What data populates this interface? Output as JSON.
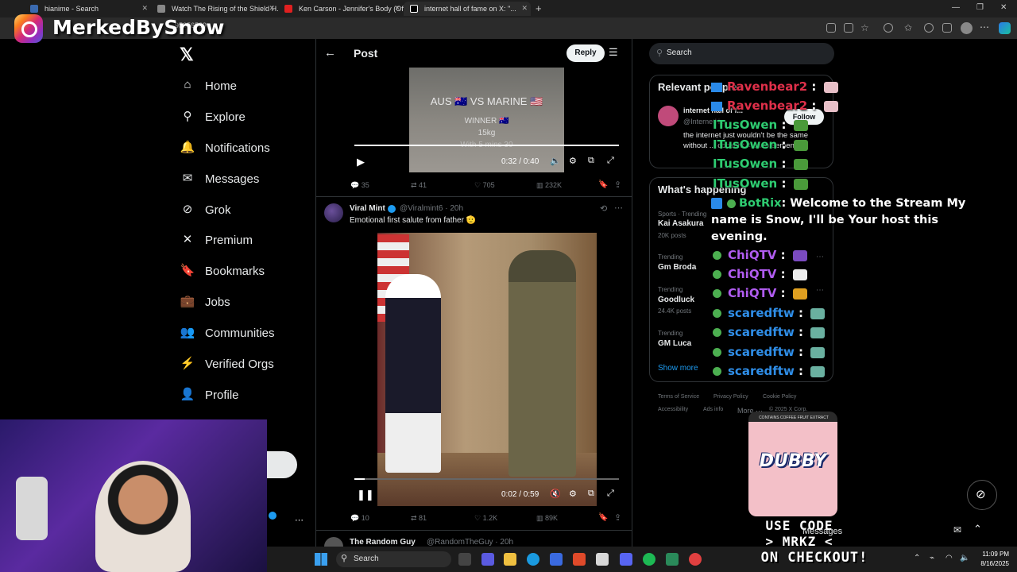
{
  "browser": {
    "tabs": [
      {
        "title": "hianime - Search",
        "active": false
      },
      {
        "title": "Watch The Rising of the Shield H...",
        "active": false
      },
      {
        "title": "Ken Carson - Jennifer's Body (Off...",
        "active": false
      },
      {
        "title": "internet hall of fame on X: \"...",
        "active": true
      }
    ],
    "url_fragment": "95656589"
  },
  "overlay": {
    "channel_name": "MerkedBySnow",
    "promo_line1": "USE CODE",
    "promo_line2": "> MRKZ <",
    "promo_line3": "ON CHECKOUT!"
  },
  "sidebar": {
    "items": [
      {
        "label": "Home",
        "icon": "home-icon"
      },
      {
        "label": "Explore",
        "icon": "search-icon"
      },
      {
        "label": "Notifications",
        "icon": "bell-icon"
      },
      {
        "label": "Messages",
        "icon": "mail-icon"
      },
      {
        "label": "Grok",
        "icon": "grok-icon"
      },
      {
        "label": "Premium",
        "icon": "x-icon"
      },
      {
        "label": "Bookmarks",
        "icon": "bookmark-icon"
      },
      {
        "label": "Jobs",
        "icon": "briefcase-icon"
      },
      {
        "label": "Communities",
        "icon": "people-icon"
      },
      {
        "label": "Verified Orgs",
        "icon": "lightning-icon"
      },
      {
        "label": "Profile",
        "icon": "person-icon"
      }
    ]
  },
  "header": {
    "title": "Post",
    "reply_label": "Reply"
  },
  "post1": {
    "video_text_title": "AUS 🇦🇺 VS MARINE 🇺🇸",
    "video_text_winner": "WINNER 🇦🇺",
    "video_text_kg": "15kg",
    "video_text_time": "With 5 mins 30",
    "time": "0:32 / 0:40",
    "progress": 1.0,
    "replies": "35",
    "reposts": "41",
    "likes": "705",
    "views": "232K"
  },
  "post2": {
    "author": "Viral Mint",
    "handle": "@Viralmint6 · 20h",
    "text": "Emotional first salute from father 🫡",
    "time": "0:02 / 0:59",
    "progress": 0.04,
    "replies": "10",
    "reposts": "81",
    "likes": "1.2K",
    "views": "89K"
  },
  "post3": {
    "author": "The Random Guy",
    "handle": "@RandomTheGuy · 20h"
  },
  "right": {
    "search_placeholder": "Search",
    "relevant_title": "Relevant people",
    "relevant_name": "internet hall of f...",
    "relevant_handle": "@InternetH...",
    "follow_label": "Follow",
    "relevant_bio": "the internet just wouldn't be the same without ... consent ≠ endorsement",
    "happening_title": "What's happening",
    "trends": [
      {
        "category": "Sports · Trending",
        "name": "Kai Asakura",
        "posts": "20K posts"
      },
      {
        "category": "Trending",
        "name": "Gm Broda",
        "posts": ""
      },
      {
        "category": "Trending",
        "name": "Goodluck",
        "posts": "24.4K posts"
      },
      {
        "category": "Trending",
        "name": "GM Luca",
        "posts": ""
      }
    ],
    "show_more": "Show more",
    "footer": [
      "Terms of Service",
      "Privacy Policy",
      "Cookie Policy",
      "Accessibility",
      "Ads info",
      "More ···",
      "© 2025 X Corp."
    ]
  },
  "chat": [
    {
      "user": "Ravenbear2",
      "color": "#e0304a"
    },
    {
      "user": "Ravenbear2",
      "color": "#e0304a"
    },
    {
      "user": "ITusOwen",
      "color": "#2ecc71"
    },
    {
      "user": "ITusOwen",
      "color": "#2ecc71"
    },
    {
      "user": "ITusOwen",
      "color": "#2ecc71"
    },
    {
      "user": "ITusOwen",
      "color": "#2ecc71"
    },
    {
      "user": "ChiQTV",
      "color": "#b05cf0"
    },
    {
      "user": "ChiQTV",
      "color": "#b05cf0"
    },
    {
      "user": "ChiQTV",
      "color": "#b05cf0"
    },
    {
      "user": "scaredftw",
      "color": "#2f8ee8"
    },
    {
      "user": "scaredftw",
      "color": "#2f8ee8"
    },
    {
      "user": "scaredftw",
      "color": "#2f8ee8"
    },
    {
      "user": "scaredftw",
      "color": "#2f8ee8"
    }
  ],
  "bot_message": {
    "user": "BotRix",
    "text": ": Welcome to the Stream My name is Snow, I'll be Your host this evening."
  },
  "product": {
    "brand": "DUBBY",
    "top_line": "CONTAINS COFFEE FRUIT EXTRACT"
  },
  "messages_bar": "Messages",
  "taskbar": {
    "search": "Search",
    "time": "11:09 PM",
    "date": "8/16/2025"
  }
}
